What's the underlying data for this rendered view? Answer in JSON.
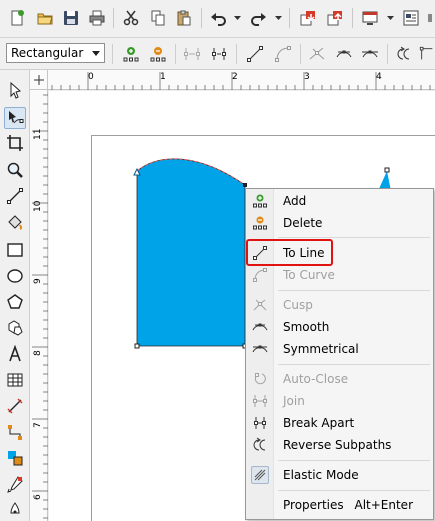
{
  "property_bar": {
    "mode_value": "Rectangular"
  },
  "rulers": {
    "horizontal_labels": [
      "0",
      "1",
      "2",
      "3",
      "4"
    ],
    "vertical_labels": [
      "11",
      "10",
      "9",
      "8",
      "7",
      "6"
    ]
  },
  "context_menu": {
    "items": [
      {
        "label": "Add",
        "icon": "add-node-icon",
        "enabled": true
      },
      {
        "label": "Delete",
        "icon": "delete-node-icon",
        "enabled": true
      },
      {
        "label": "To Line",
        "icon": "to-line-icon",
        "enabled": true,
        "highlighted": true
      },
      {
        "label": "To Curve",
        "icon": "to-curve-icon",
        "enabled": false
      },
      {
        "label": "Cusp",
        "icon": "cusp-icon",
        "enabled": false
      },
      {
        "label": "Smooth",
        "icon": "smooth-icon",
        "enabled": true
      },
      {
        "label": "Symmetrical",
        "icon": "symmetrical-icon",
        "enabled": true
      },
      {
        "label": "Auto-Close",
        "icon": "auto-close-icon",
        "enabled": false
      },
      {
        "label": "Join",
        "icon": "join-icon",
        "enabled": false
      },
      {
        "label": "Break Apart",
        "icon": "break-apart-icon",
        "enabled": true
      },
      {
        "label": "Reverse Subpaths",
        "icon": "reverse-subpaths-icon",
        "enabled": true
      },
      {
        "label": "Elastic Mode",
        "icon": "elastic-mode-icon",
        "enabled": true
      },
      {
        "label": "Properties",
        "shortcut": "Alt+Enter",
        "enabled": true
      }
    ],
    "highlight_color": "#e01212"
  },
  "colors": {
    "shape_fill": "#00a2e8",
    "accent_green": "#3a9b2c",
    "accent_orange": "#e08a18",
    "accent_red": "#d43a2a"
  }
}
